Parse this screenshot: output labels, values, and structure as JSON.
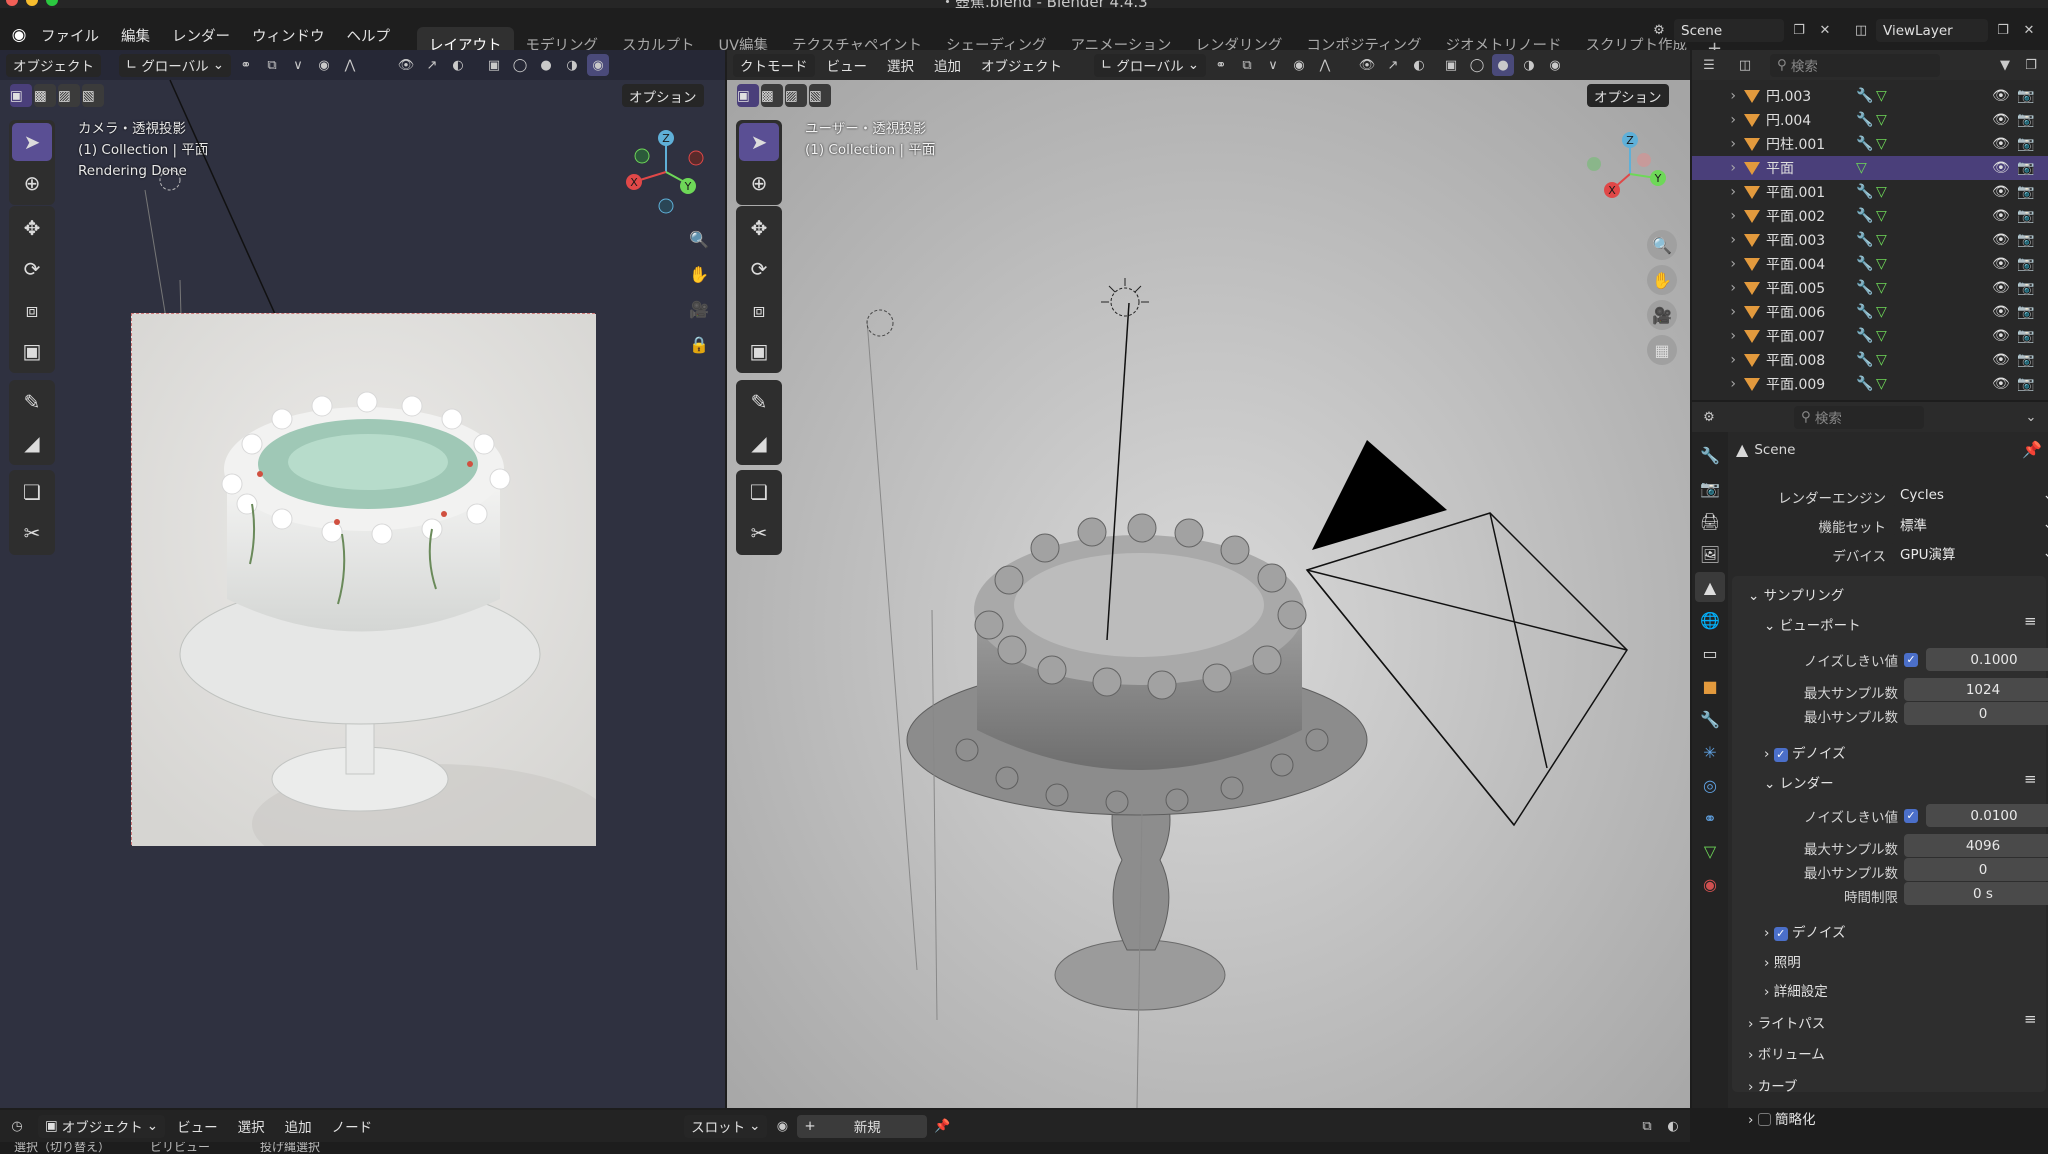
{
  "window": {
    "title": "・壺蕉.blend - Blender 4.4.3"
  },
  "menu": [
    "ファイル",
    "編集",
    "レンダー",
    "ウィンドウ",
    "ヘルプ"
  ],
  "workspaces": [
    "レイアウト",
    "モデリング",
    "スカルプト",
    "UV編集",
    "テクスチャペイント",
    "シェーディング",
    "アニメーション",
    "レンダリング",
    "コンポジティング",
    "ジオメトリノード",
    "スクリプト作成"
  ],
  "scene": {
    "name": "Scene",
    "view_layer": "ViewLayer"
  },
  "left_view": {
    "mode": "オブジェクト",
    "orientation": "グローバル",
    "options": "オプション",
    "overlay": [
      "カメラ・透視投影",
      "(1) Collection | 平面",
      "Rendering Done"
    ]
  },
  "mid_view": {
    "mode": "クトモード",
    "menus": [
      "ビュー",
      "選択",
      "追加",
      "オブジェクト"
    ],
    "orientation": "グローバル",
    "options": "オプション",
    "overlay": [
      "ユーザー・透視投影",
      "(1) Collection | 平面"
    ]
  },
  "gizmo": {
    "x": "X",
    "y": "Y",
    "z": "Z"
  },
  "outliner": {
    "search_placeholder": "検索",
    "items": [
      "円.003",
      "円.004",
      "円柱.001",
      "平面",
      "平面.001",
      "平面.002",
      "平面.003",
      "平面.004",
      "平面.005",
      "平面.006",
      "平面.007",
      "平面.008",
      "平面.009"
    ],
    "selected_index": 3
  },
  "properties": {
    "search_placeholder": "検索",
    "context": "Scene",
    "render_engine_label": "レンダーエンジン",
    "render_engine": "Cycles",
    "feature_set_label": "機能セット",
    "feature_set": "標準",
    "device_label": "デバイス",
    "device": "GPU演算",
    "sampling": "サンプリング",
    "viewport": "ビューポート",
    "noise_threshold_label": "ノイズしきい値",
    "viewport_noise": "0.1000",
    "max_samples_label": "最大サンプル数",
    "viewport_max": "1024",
    "min_samples_label": "最小サンプル数",
    "viewport_min": "0",
    "denoise": "デノイズ",
    "render": "レンダー",
    "render_noise": "0.0100",
    "render_max": "4096",
    "render_min": "0",
    "time_limit_label": "時間制限",
    "time_limit": "0 s",
    "lights": "照明",
    "advanced": "詳細設定",
    "light_paths": "ライトパス",
    "volumes": "ボリューム",
    "curves": "カーブ",
    "simplify": "簡略化"
  },
  "bottom": {
    "mode": "オブジェクト",
    "menus": [
      "ビュー",
      "選択",
      "追加",
      "ノード"
    ],
    "slot": "スロット",
    "new": "新規"
  },
  "status": [
    "選択（切り替え）",
    "ビリビュー",
    "投げ縄選択"
  ],
  "colors": {
    "accent": "#5a4f94",
    "object": "#e39a3d",
    "axis_x": "#e04848",
    "axis_y": "#6ed858",
    "axis_z": "#5fb0d8"
  }
}
